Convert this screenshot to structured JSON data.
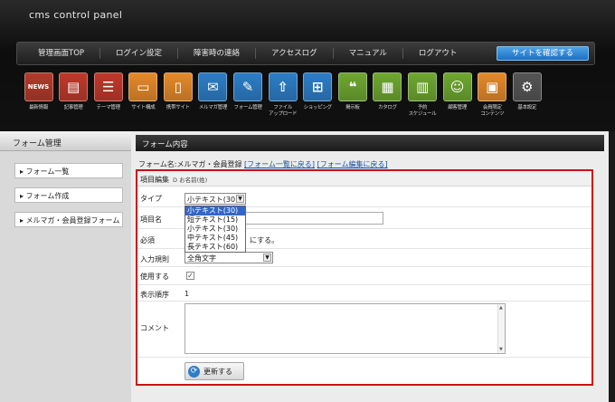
{
  "header": {
    "brand": "cms control panel"
  },
  "nav": {
    "items": [
      "管理画面TOP",
      "ログイン設定",
      "障害時の連絡",
      "アクセスログ",
      "マニュアル",
      "ログアウト"
    ],
    "site_button": "サイトを確認する"
  },
  "tools": [
    {
      "label": "最新情報",
      "icon": "newspaper-icon",
      "glyph": "NEWS",
      "color": "#b33a2a"
    },
    {
      "label": "記事管理",
      "icon": "document-icon",
      "glyph": "▤",
      "color": "#c0392b"
    },
    {
      "label": "テーマ管理",
      "icon": "list-icon",
      "glyph": "☰",
      "color": "#c0392b"
    },
    {
      "label": "サイト構成",
      "icon": "monitor-icon",
      "glyph": "▭",
      "color": "#e58a2a"
    },
    {
      "label": "携帯サイト",
      "icon": "mobile-icon",
      "glyph": "▯",
      "color": "#e58a2a"
    },
    {
      "label": "メルマガ管理",
      "icon": "mail-icon",
      "glyph": "✉",
      "color": "#2d7ec7"
    },
    {
      "label": "フォーム管理",
      "icon": "form-icon",
      "glyph": "✎",
      "color": "#2d7ec7"
    },
    {
      "label": "ファイル\nアップロード",
      "icon": "file-upload-icon",
      "glyph": "⇧",
      "color": "#2d7ec7"
    },
    {
      "label": "ショッピング",
      "icon": "cart-icon",
      "glyph": "⊞",
      "color": "#2d7ec7"
    },
    {
      "label": "掲示板",
      "icon": "chat-icon",
      "glyph": "❝",
      "color": "#6ea830"
    },
    {
      "label": "カタログ",
      "icon": "catalog-icon",
      "glyph": "▦",
      "color": "#6ea830"
    },
    {
      "label": "予約\nスケジュール",
      "icon": "calendar-icon",
      "glyph": "▥",
      "color": "#6ea830"
    },
    {
      "label": "顧客管理",
      "icon": "users-icon",
      "glyph": "☺",
      "color": "#6ea830"
    },
    {
      "label": "会員限定\nコンテンツ",
      "icon": "lock-icon",
      "glyph": "▣",
      "color": "#e58a2a"
    },
    {
      "label": "基本設定",
      "icon": "gear-icon",
      "glyph": "⚙",
      "color": "#555555"
    }
  ],
  "sidebar": {
    "title": "フォーム管理",
    "items": [
      "フォーム一覧",
      "フォーム作成",
      "メルマガ・会員登録フォーム"
    ]
  },
  "main": {
    "title": "フォーム内容",
    "form_name_label": "フォーム名:メルマガ・会員登録",
    "link_back_list": "[フォーム一覧に戻る]",
    "link_back_edit": "[フォーム編集に戻る]"
  },
  "editor": {
    "header": "項目編集",
    "header_sub": "D お名前(姓)",
    "type_label": "タイプ",
    "type_value": "小テキスト(30)",
    "type_options": [
      "小テキスト(30)",
      "短テキスト(15)",
      "小テキスト(30)",
      "中テキスト(45)",
      "長テキスト(60)"
    ],
    "name_label": "項目名",
    "required_label": "必須",
    "required_text": "にする。",
    "input_rule_label": "入力規則",
    "input_rule_value": "全角文字",
    "use_label": "使用する",
    "use_checked": "✓",
    "order_label": "表示順序",
    "order_value": "1",
    "comment_label": "コメント",
    "update_button": "更新する"
  }
}
